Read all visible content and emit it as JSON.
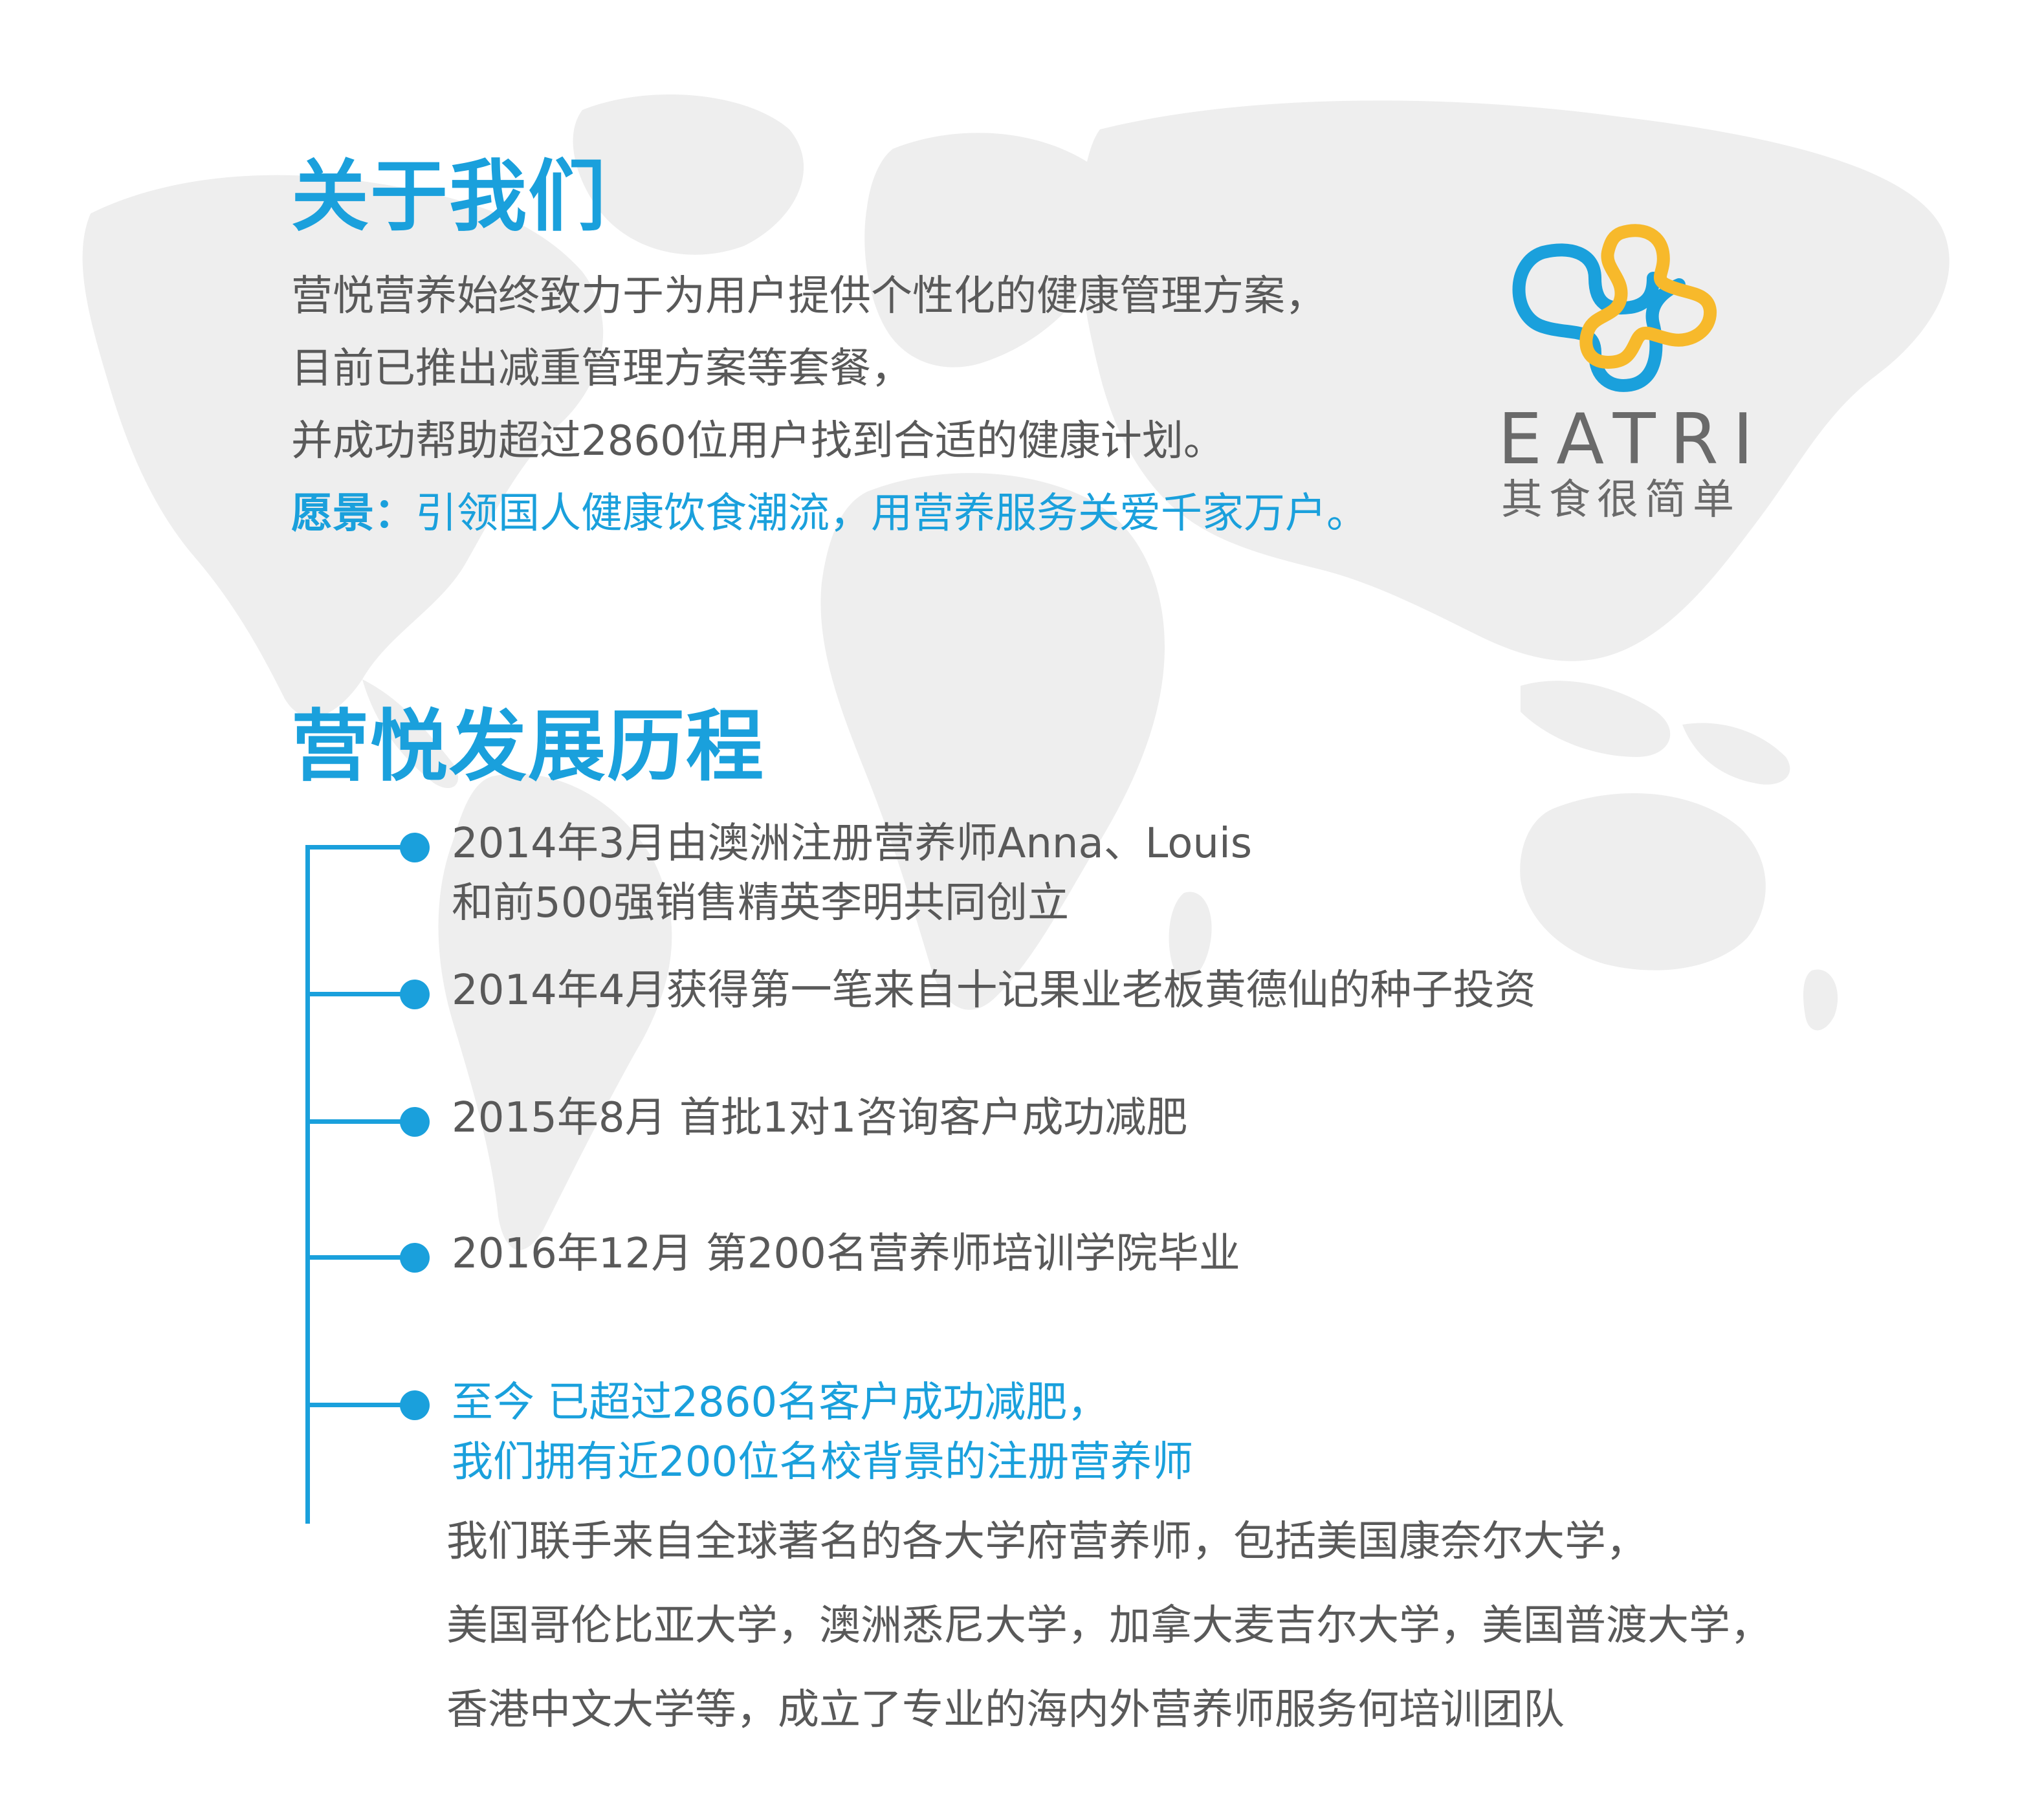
{
  "about": {
    "title": "关于我们",
    "lines": [
      "营悦营养始终致力于为用户提供个性化的健康管理方案，",
      "目前已推出减重管理方案等套餐，",
      "并成功帮助超过2860位用户找到合适的健康计划。"
    ],
    "vision_label": "愿景：",
    "vision_text": "引领国人健康饮食潮流，用营养服务关爱千家万户。"
  },
  "logo": {
    "name": "EATRI",
    "tagline": "其食很简单",
    "colors": {
      "blue": "#1aa0dc",
      "yellow": "#f7b92b"
    }
  },
  "history": {
    "title": "营悦发展历程",
    "items": [
      {
        "lines": [
          "2014年3月由澳洲注册营养师Anna、Louis",
          "和前500强销售精英李明共同创立"
        ]
      },
      {
        "lines": [
          "2014年4月获得第一笔来自十记果业老板黄德仙的种子投资"
        ]
      },
      {
        "lines": [
          "2015年8月 首批1对1咨询客户成功减肥"
        ]
      },
      {
        "lines": [
          "2016年12月 第200名营养师培训学院毕业"
        ]
      },
      {
        "lines": [
          "至今 已超过2860名客户成功减肥，",
          "我们拥有近200位名校背景的注册营养师"
        ]
      }
    ],
    "partners": [
      "我们联手来自全球著名的各大学府营养师，包括美国康奈尔大学，",
      "美国哥伦比亚大学，澳洲悉尼大学，加拿大麦吉尔大学，美国普渡大学，",
      "香港中文大学等，成立了专业的海内外营养师服务何培训团队"
    ]
  },
  "colors": {
    "accent": "#1aa0dc",
    "text": "#595959",
    "map": "#efefef"
  }
}
